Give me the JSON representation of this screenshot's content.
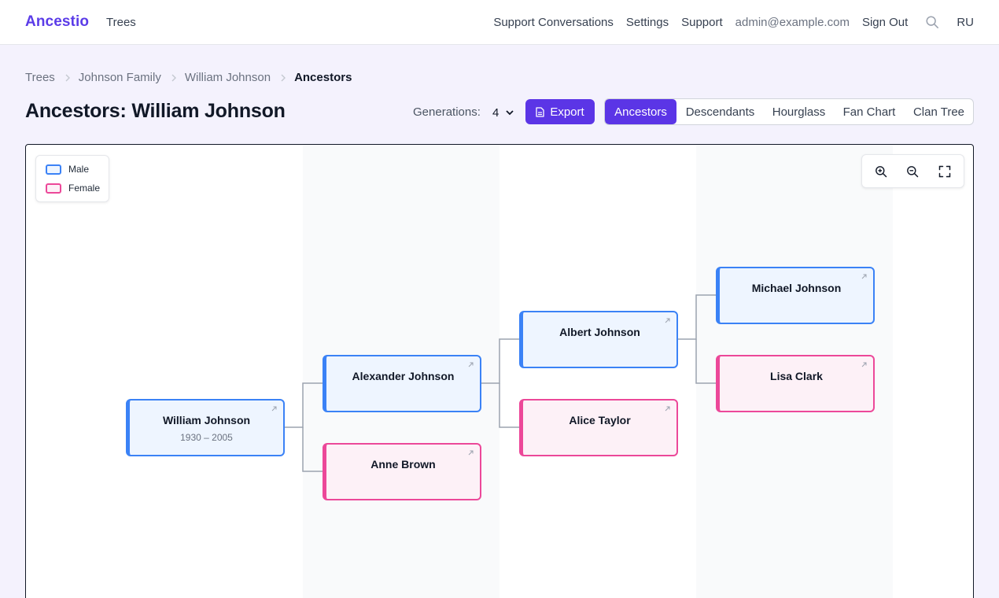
{
  "header": {
    "brand": "Ancestio",
    "nav_trees": "Trees",
    "links": [
      "Support Conversations",
      "Settings",
      "Support"
    ],
    "email": "admin@example.com",
    "sign_out": "Sign Out",
    "language": "RU"
  },
  "breadcrumb": [
    "Trees",
    "Johnson Family",
    "William Johnson",
    "Ancestors"
  ],
  "page": {
    "title": "Ancestors: William Johnson",
    "generations_label": "Generations:",
    "generations_value": "4",
    "export_label": "Export"
  },
  "view_tabs": [
    "Ancestors",
    "Descendants",
    "Hourglass",
    "Fan Chart",
    "Clan Tree"
  ],
  "active_tab": "Ancestors",
  "legend": {
    "male": "Male",
    "female": "Female"
  },
  "colors": {
    "male": "#3b82f6",
    "female": "#ec4899",
    "accent": "#5b35e6"
  },
  "persons": {
    "william": {
      "name": "William Johnson",
      "dates": "1930 – 2005",
      "sex": "male"
    },
    "alexander": {
      "name": "Alexander Johnson",
      "sex": "male"
    },
    "anne": {
      "name": "Anne Brown",
      "sex": "female"
    },
    "albert": {
      "name": "Albert Johnson",
      "sex": "male"
    },
    "alice": {
      "name": "Alice Taylor",
      "sex": "female"
    },
    "michael": {
      "name": "Michael Johnson",
      "sex": "male"
    },
    "lisa": {
      "name": "Lisa Clark",
      "sex": "female"
    }
  },
  "icons": {
    "search": "search-icon",
    "export": "document-icon",
    "zoom_in": "zoom-in-icon",
    "zoom_out": "zoom-out-icon",
    "fit": "fullscreen-icon",
    "open": "external-link-icon"
  }
}
